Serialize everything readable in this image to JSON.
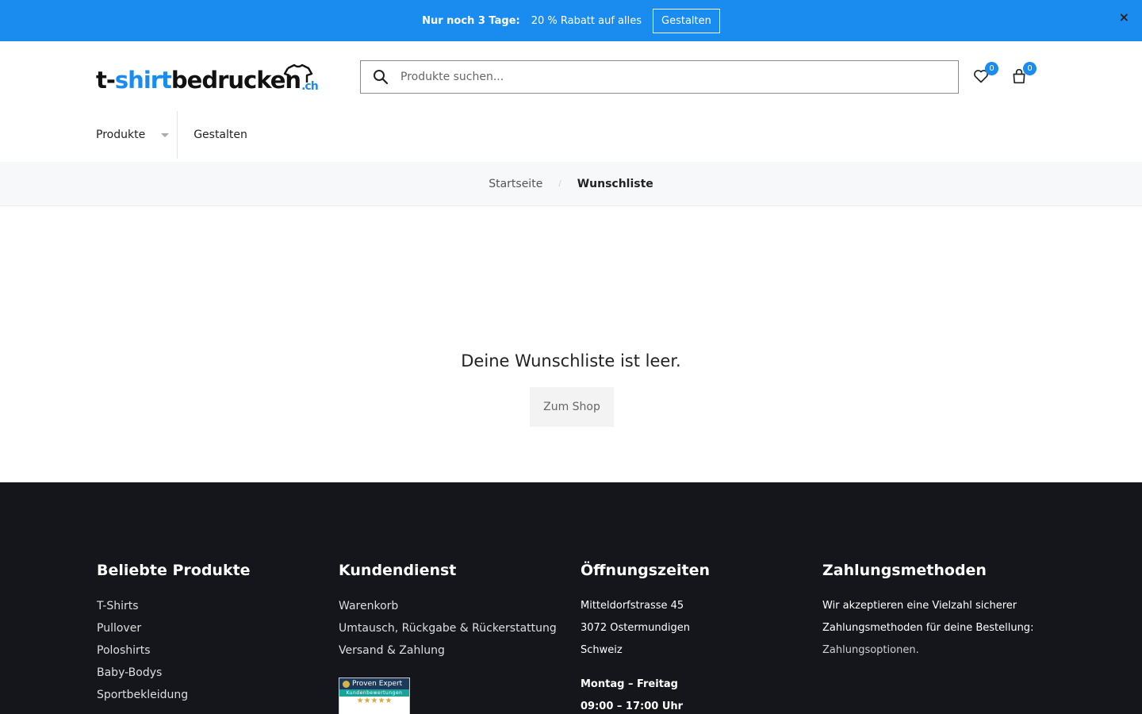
{
  "promo": {
    "lead": "Nur noch 3 Tage:",
    "text": "20 % Rabatt auf alles",
    "cta": "Gestalten",
    "close": "×",
    "bg_color": "#1a8cf0"
  },
  "header": {
    "logo": {
      "part1": "t-",
      "part2": "shirt",
      "part3": "bedrucken",
      "tld": ".ch"
    },
    "search": {
      "placeholder": "Produkte suchen...",
      "icon": "search-icon"
    },
    "wishlist": {
      "icon": "heart-icon",
      "count": "0"
    },
    "cart": {
      "icon": "shopping-bag-icon",
      "count": "0"
    }
  },
  "nav": {
    "products": "Produkte",
    "design": "Gestalten"
  },
  "breadcrumb": {
    "home": "Startseite",
    "separator": "/",
    "current": "Wunschliste"
  },
  "main": {
    "empty_message": "Deine Wunschliste ist leer.",
    "shop_button": "Zum Shop"
  },
  "footer": {
    "popular": {
      "title": "Beliebte Produkte",
      "links": [
        "T-Shirts",
        "Pullover",
        "Poloshirts",
        "Baby-Bodys",
        "Sportbekleidung"
      ]
    },
    "service": {
      "title": "Kundendienst",
      "links": [
        "Warenkorb",
        "Umtausch, Rückgabe & Rückerstattung",
        "Versand & Zahlung"
      ],
      "badge": {
        "brand": "Proven Expert",
        "sub": "Kundenbewertungen",
        "stars": "★★★★★"
      }
    },
    "hours": {
      "title": "Öffnungszeiten",
      "address": [
        "Mitteldorfstrasse 45",
        "3072 Ostermundigen",
        "Schweiz"
      ],
      "days": "Montag – Freitag",
      "time": "09:00 – 17:00 Uhr"
    },
    "payment": {
      "title": "Zahlungsmethoden",
      "text_line1": "Wir akzeptieren eine Vielzahl sicherer",
      "text_line2": "Zahlungsmethoden für deine Bestellung:",
      "link": "Zahlungsoptionen."
    }
  }
}
